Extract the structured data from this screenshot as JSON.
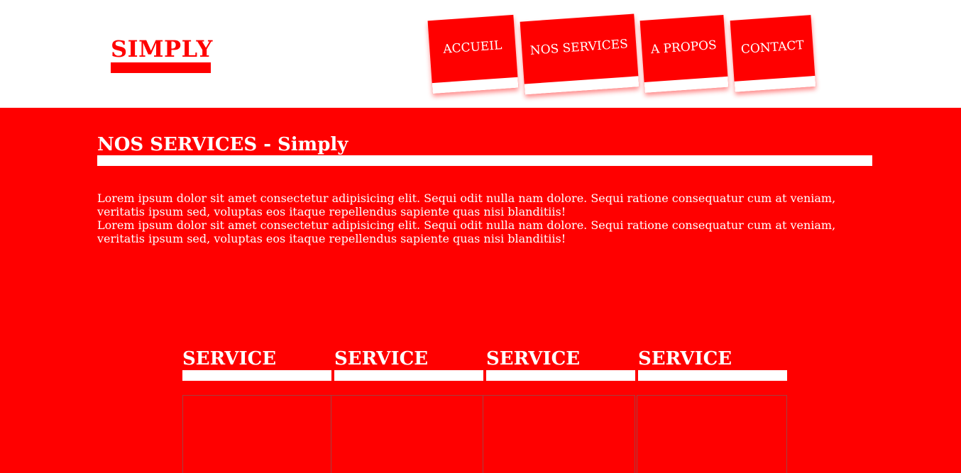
{
  "header": {
    "logo": "SIMPLY",
    "nav": [
      {
        "label": "ACCUEIL"
      },
      {
        "label": "NOS SERVICES"
      },
      {
        "label": "A PROPOS"
      },
      {
        "label": "CONTACT"
      }
    ]
  },
  "main": {
    "title": "NOS SERVICES - Simply",
    "paragraphs": [
      "Lorem ipsum dolor sit amet consectetur adipisicing elit. Sequi odit nulla nam dolore. Sequi ratione consequatur cum at veniam, veritatis ipsum sed, voluptas eos itaque repellendus sapiente quas nisi blanditiis!",
      "Lorem ipsum dolor sit amet consectetur adipisicing elit. Sequi odit nulla nam dolore. Sequi ratione consequatur cum at veniam, veritatis ipsum sed, voluptas eos itaque repellendus sapiente quas nisi blanditiis!"
    ]
  },
  "services": [
    {
      "title": "SERVICE"
    },
    {
      "title": "SERVICE"
    },
    {
      "title": "SERVICE"
    },
    {
      "title": "SERVICE"
    }
  ],
  "colors": {
    "accent": "#ff0000",
    "background": "#ff0000",
    "header_bg": "#ffffff",
    "text": "#ffffff"
  }
}
